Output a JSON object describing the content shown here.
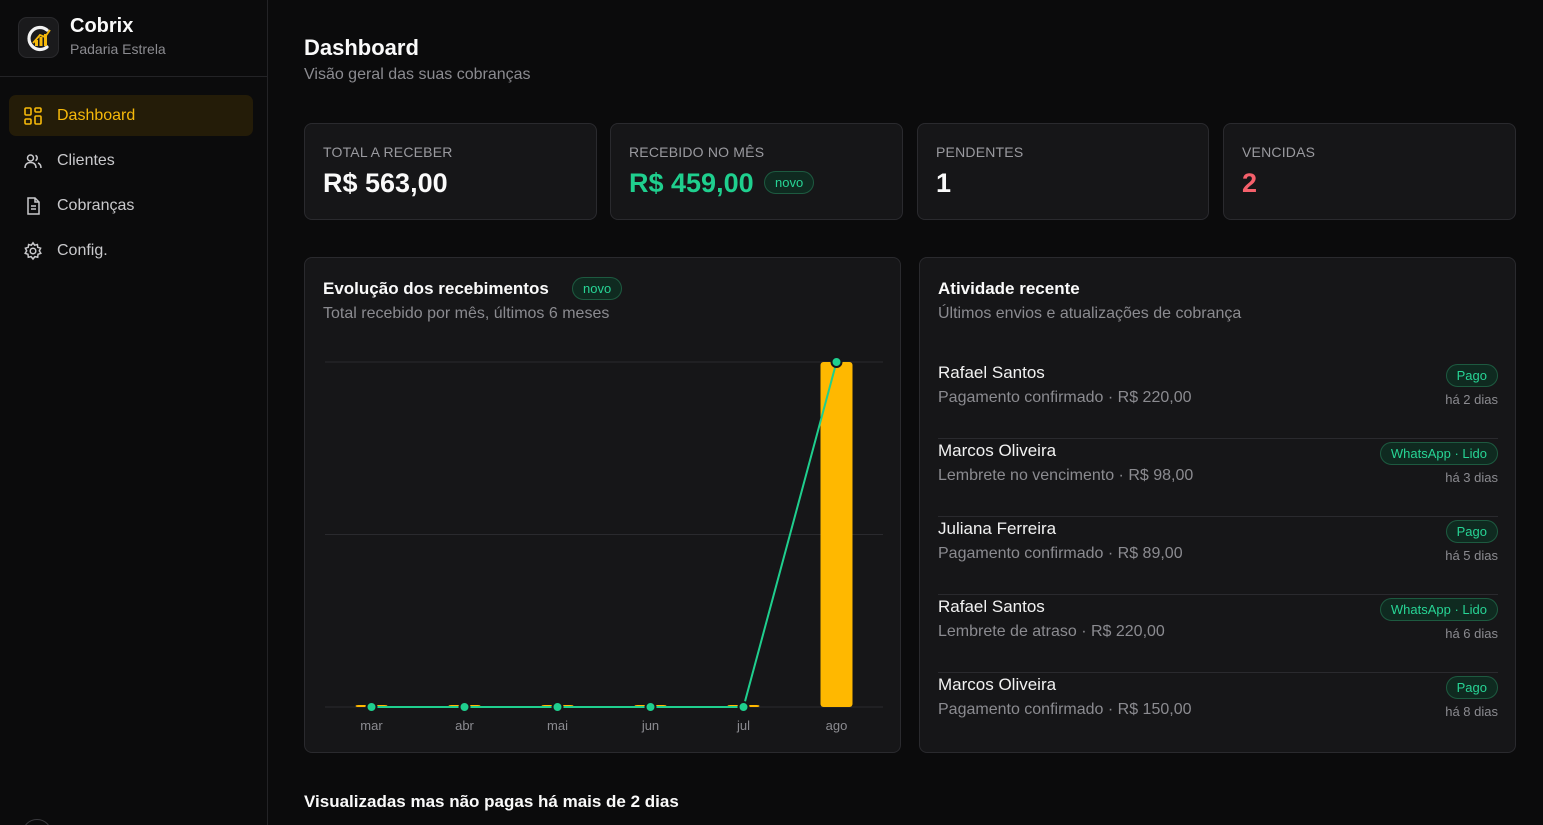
{
  "brand": {
    "name": "Cobrix",
    "subtitle": "Padaria Estrela"
  },
  "nav": [
    {
      "label": "Dashboard",
      "icon": "grid-icon",
      "active": true
    },
    {
      "label": "Clientes",
      "icon": "users-icon",
      "active": false
    },
    {
      "label": "Cobranças",
      "icon": "document-icon",
      "active": false
    },
    {
      "label": "Config.",
      "icon": "gear-icon",
      "active": false
    }
  ],
  "header": {
    "title": "Dashboard",
    "subtitle": "Visão geral das suas cobranças"
  },
  "stats": [
    {
      "label": "TOTAL A RECEBER",
      "value": "R$ 563,00"
    },
    {
      "label": "RECEBIDO NO MÊS",
      "value": "R$ 459,00",
      "badge": "novo"
    },
    {
      "label": "PENDENTES",
      "value": "1"
    },
    {
      "label": "VENCIDAS",
      "value": "2"
    }
  ],
  "chart_panel": {
    "title": "Evolução dos recebimentos",
    "badge": "novo",
    "subtitle": "Total recebido por mês, últimos 6 meses"
  },
  "chart_data": {
    "type": "bar",
    "categories": [
      "mar",
      "abr",
      "mai",
      "jun",
      "jul",
      "ago"
    ],
    "series": [
      {
        "type": "bar",
        "values": [
          0,
          0,
          0,
          0,
          0,
          459
        ]
      },
      {
        "type": "line",
        "values": [
          0,
          0,
          0,
          0,
          0,
          459
        ]
      }
    ],
    "ylim": [
      0,
      459
    ],
    "grid": true,
    "colors": {
      "bar": "#ffb800",
      "line": "#1fcf8e"
    }
  },
  "activity": {
    "title": "Atividade recente",
    "subtitle": "Últimos envios e atualizações de cobrança",
    "items": [
      {
        "name": "Rafael Santos",
        "detail": "Pagamento confirmado · R$ 220,00",
        "badge": "Pago",
        "time": "há 2 dias"
      },
      {
        "name": "Marcos Oliveira",
        "detail": "Lembrete no vencimento · R$ 98,00",
        "badge": "WhatsApp · Lido",
        "time": "há 3 dias"
      },
      {
        "name": "Juliana Ferreira",
        "detail": "Pagamento confirmado · R$ 89,00",
        "badge": "Pago",
        "time": "há 5 dias"
      },
      {
        "name": "Rafael Santos",
        "detail": "Lembrete de atraso · R$ 220,00",
        "badge": "WhatsApp · Lido",
        "time": "há 6 dias"
      },
      {
        "name": "Marcos Oliveira",
        "detail": "Pagamento confirmado · R$ 150,00",
        "badge": "Pago",
        "time": "há 8 dias"
      }
    ]
  },
  "bottom_section": {
    "title": "Visualizadas mas não pagas há mais de 2 dias"
  },
  "colors": {
    "accent": "#f6b90a",
    "success": "#1fcf8e",
    "danger": "#f5606b",
    "background": "#0b0b0c",
    "card": "#161618"
  }
}
